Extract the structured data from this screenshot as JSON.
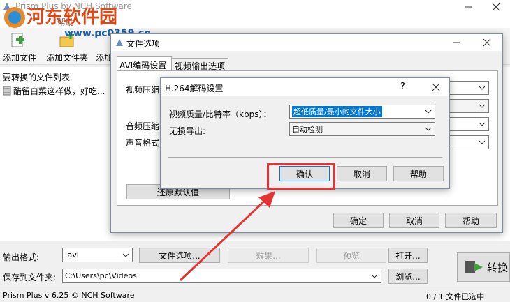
{
  "watermark": {
    "site_name": "河东软件园",
    "url": "www.pc0359.cn"
  },
  "main_window": {
    "title": "Prism Plus by NCH Software",
    "menu_items": [
      "帮助"
    ],
    "toolbar": {
      "add_file": "添加文件",
      "add_folder": "添加文件夹",
      "add_partial": "添加"
    },
    "list_header": "要转换的文件列表",
    "list_items": [
      {
        "name": "醋留白菜这样做，好吃..."
      }
    ],
    "output_format_label": "输出格式:",
    "output_format_value": ".avi",
    "file_options_button": "文件选项...",
    "effects_button": "效果...",
    "preview_button": "预览",
    "open_button": "打开...",
    "convert_button": "转换",
    "save_to_label": "保存到文件夹:",
    "save_to_value": "C:\\Users\\pc\\Videos",
    "browse_button": "浏览...",
    "status_left": "Prism Plus v 6.25 © NCH Software",
    "status_right": "0 / 1 文件已选中"
  },
  "file_options_dialog": {
    "title": "文件选项",
    "tabs": [
      {
        "label": "AVI编码设置"
      },
      {
        "label": "视频输出选项"
      }
    ],
    "video_compression_label": "视频压缩",
    "audio_compression_label": "音频压缩",
    "sound_format_label": "声音格式",
    "restore_defaults_button": "还原默认值",
    "ok_button": "确定",
    "cancel_button": "取消",
    "help_button": "帮助"
  },
  "h264_dialog": {
    "title": "H.264解码设置",
    "help_glyph": "?",
    "quality_label": "视频质量/比特率（kbps）：",
    "quality_value": "超低质量/最小的文件大小",
    "lossless_label": "无损导出:",
    "lossless_value": "自动检测",
    "ok_button": "确认",
    "cancel_button": "取消",
    "help_button": "帮助"
  },
  "colors": {
    "highlight": "#e53333",
    "selection": "#0078d7",
    "accent_green": "#3ca03c"
  }
}
